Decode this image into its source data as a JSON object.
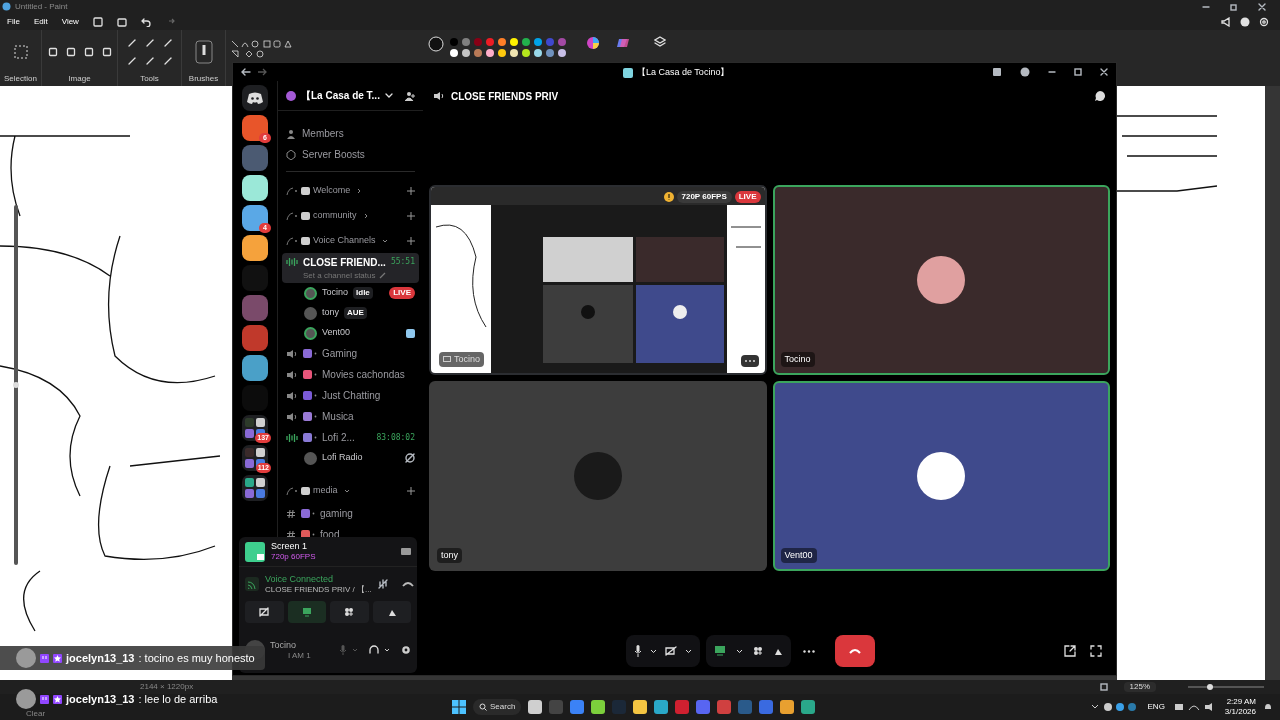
{
  "paint": {
    "title": "Untitled - Paint",
    "menu": [
      "File",
      "Edit",
      "View"
    ],
    "groups": [
      "Selection",
      "Image",
      "Tools",
      "Brushes"
    ],
    "palette": [
      {
        "color": "#000000"
      },
      {
        "color": "#7f7f7f"
      },
      {
        "color": "#880015"
      },
      {
        "color": "#ed1c24"
      },
      {
        "color": "#ff7f27"
      },
      {
        "color": "#fff200"
      },
      {
        "color": "#22b14c"
      },
      {
        "color": "#00a2e8"
      },
      {
        "color": "#3f48cc"
      },
      {
        "color": "#a349a4"
      },
      {
        "color": "#ffffff"
      },
      {
        "color": "#c3c3c3"
      },
      {
        "color": "#b97a57"
      },
      {
        "color": "#ffaec9"
      },
      {
        "color": "#ffc90e"
      },
      {
        "color": "#efe4b0"
      },
      {
        "color": "#b5e61d"
      },
      {
        "color": "#99d9ea"
      },
      {
        "color": "#7092be"
      },
      {
        "color": "#c8bfe7"
      }
    ],
    "status": {
      "size": "2144 × 1220px",
      "zoom": "125%"
    }
  },
  "discord": {
    "title": "【La Casa de Tocino】",
    "servers": [
      {
        "kind": "server",
        "badge": "6"
      },
      {
        "kind": "server"
      },
      {
        "kind": "server"
      },
      {
        "kind": "server",
        "badge": "4"
      },
      {
        "kind": "server"
      },
      {
        "kind": "server"
      },
      {
        "kind": "server"
      },
      {
        "kind": "server"
      },
      {
        "kind": "server"
      },
      {
        "kind": "server"
      },
      {
        "kind": "folder",
        "badge": "137"
      },
      {
        "kind": "folder",
        "badge": "112"
      },
      {
        "kind": "folder"
      }
    ],
    "server_name": "【La Casa de T...",
    "top_items": [
      "Members",
      "Server Boosts"
    ],
    "channels": [
      {
        "kind": "category",
        "label": "Welcome",
        "expanded": false
      },
      {
        "kind": "category",
        "label": "community",
        "expanded": false
      },
      {
        "kind": "category",
        "label": "Voice Channels",
        "expanded": true
      },
      {
        "kind": "voice",
        "label": "CLOSE FRIEND...",
        "timer": "55:51",
        "status": "Set a channel status",
        "selected": true,
        "active": true,
        "children": [
          {
            "name": "Tocino",
            "tag": "Idle",
            "live": "LIVE",
            "speaking": true
          },
          {
            "name": "tony",
            "tag": "AUE",
            "speaking": false
          },
          {
            "name": "Vent00",
            "speaking": true
          }
        ]
      },
      {
        "kind": "voice",
        "label": "Gaming",
        "selected": false,
        "active": false
      },
      {
        "kind": "voice",
        "label": "Movies cachondas",
        "selected": false,
        "active": false
      },
      {
        "kind": "voice",
        "label": "Just Chatting",
        "selected": false,
        "active": false
      },
      {
        "kind": "voice",
        "label": "Musica",
        "selected": false,
        "active": false
      },
      {
        "kind": "voice",
        "label": "Lofi 2...",
        "timer": "83:08:02",
        "selected": false,
        "active": true,
        "children": [
          {
            "name": "Lofi Radio",
            "speaking": false
          }
        ]
      },
      {
        "kind": "category",
        "label": "media",
        "expanded": true
      },
      {
        "kind": "text",
        "label": "gaming"
      },
      {
        "kind": "text",
        "label": "food"
      }
    ],
    "stream_panel": {
      "title": "Screen 1",
      "quality": "720p 60FPS"
    },
    "voice": {
      "status": "Voice Connected",
      "channel": "CLOSE FRIENDS PRIV / 【..."
    },
    "user": {
      "name": "Tocino",
      "status": "I AM 1"
    },
    "channel_title": "CLOSE FRIENDS PRIV",
    "tiles": [
      {
        "kind": "stream",
        "name": "Tocino",
        "quality": "720P 60FPS",
        "live": "LIVE",
        "speaking": false,
        "color": "#2b2d31"
      },
      {
        "kind": "user",
        "name": "Tocino",
        "speaking": true,
        "color": "#3a2a2b"
      },
      {
        "kind": "user",
        "name": "tony",
        "speaking": false,
        "color": "#3d3d3d"
      },
      {
        "kind": "user",
        "name": "Vent00",
        "speaking": true,
        "color": "#3f4a8c"
      }
    ]
  },
  "chat": [
    {
      "user": "jocelyn13_13",
      "text": ": tocino es muy honesto"
    },
    {
      "user": "jocelyn13_13",
      "text": ": lee lo de arriba"
    }
  ],
  "chat_clear": "Clear",
  "taskbar": {
    "search": "Search",
    "lang": "ENG",
    "time": "2:29 AM",
    "date": "3/1/2026"
  }
}
